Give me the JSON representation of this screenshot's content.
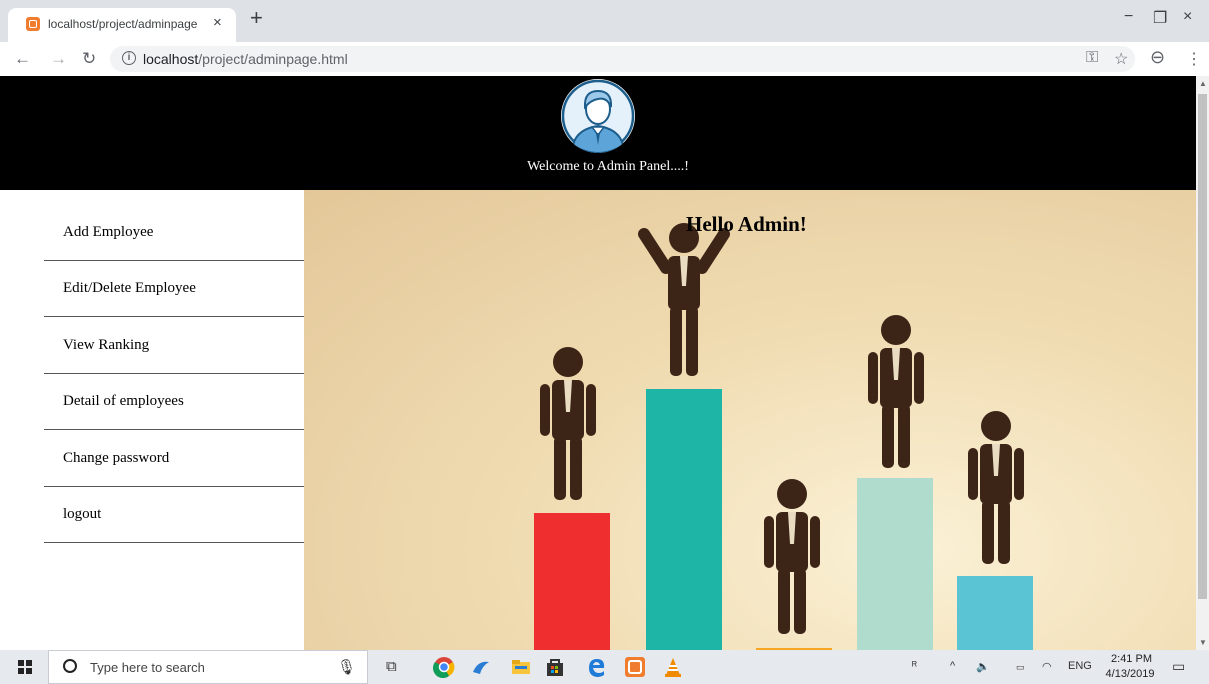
{
  "browser": {
    "tab_title": "localhost/project/adminpage.htm",
    "tab_close": "×",
    "new_tab": "+",
    "url_host": "localhost",
    "url_path": "/project/adminpage.html",
    "window_controls": [
      "−",
      "❐",
      "×"
    ]
  },
  "header": {
    "welcome_text": "Welcome to Admin Panel....!"
  },
  "sidebar": {
    "items": [
      {
        "label": "Add Employee"
      },
      {
        "label": "Edit/Delete Employee"
      },
      {
        "label": "View Ranking"
      },
      {
        "label": "Detail of employees"
      },
      {
        "label": "Change password"
      },
      {
        "label": "logout"
      }
    ]
  },
  "content": {
    "greeting": "Hello Admin!",
    "podium_colors": [
      "#ee2e2f",
      "#1fb5a6",
      "#f5a623",
      "#b0dccd",
      "#5bc4d4"
    ],
    "figure_color": "#3c2417"
  },
  "taskbar": {
    "search_placeholder": "Type here to search",
    "lang": "ENG",
    "time": "2:41 PM",
    "date": "4/13/2019"
  }
}
